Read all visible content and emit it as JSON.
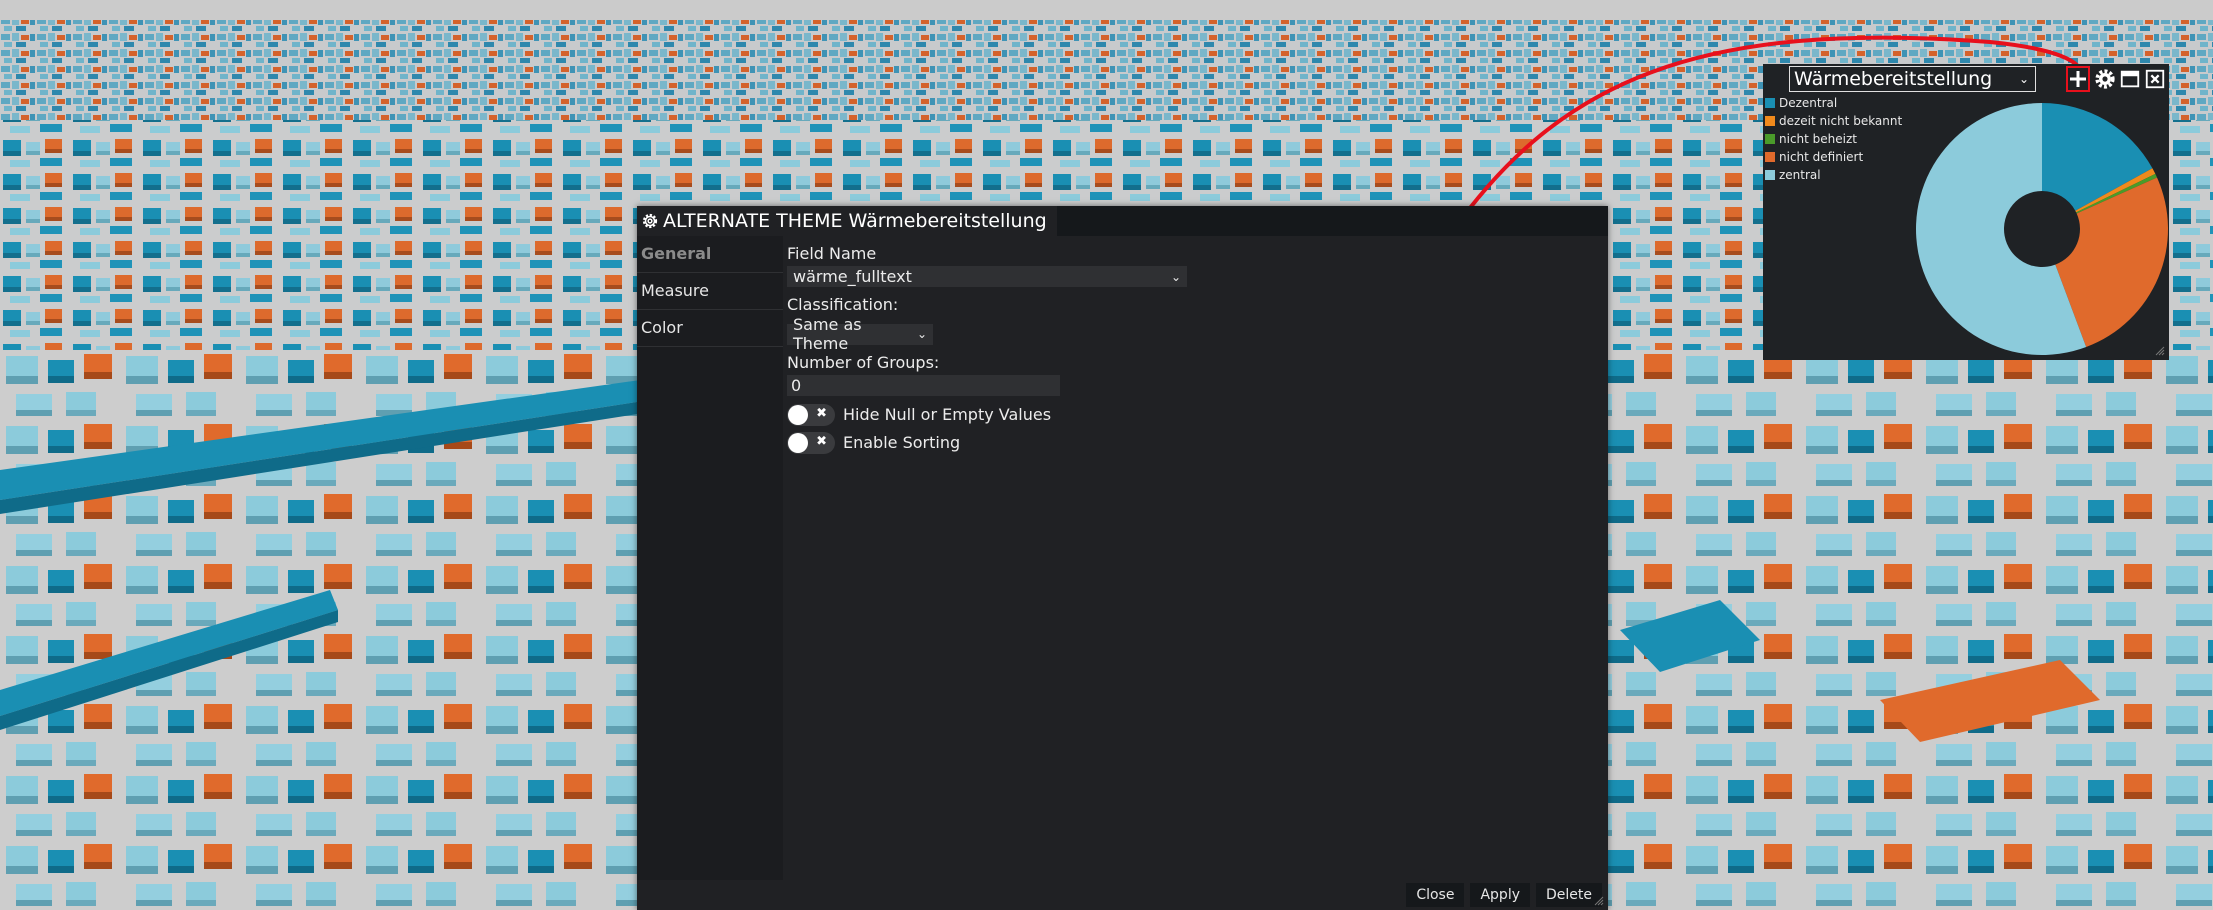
{
  "colors": {
    "dezentral": "#1a8fb3",
    "unknown": "#f08a1c",
    "not_heated": "#4a9b2a",
    "undefined": "#e06a2c",
    "zentral": "#8ccbdb",
    "annotation": "#e8101c"
  },
  "dialog": {
    "icon": "gear-icon",
    "title": "ALTERNATE THEME Wärmebereitstellung",
    "nav": [
      {
        "label": "General"
      },
      {
        "label": "Measure"
      },
      {
        "label": "Color"
      }
    ],
    "field_name": {
      "label": "Field Name",
      "value": "wärme_fulltext"
    },
    "classification": {
      "label": "Classification:",
      "value": "Same as Theme"
    },
    "groups": {
      "label": "Number of Groups:",
      "value": "0"
    },
    "toggles": [
      {
        "label": "Hide Null or Empty Values",
        "on": false
      },
      {
        "label": "Enable Sorting",
        "on": false
      }
    ],
    "buttons": {
      "close": "Close",
      "apply": "Apply",
      "delete": "Delete"
    }
  },
  "chart_panel": {
    "dropdown_value": "Wärmebereitstellung",
    "icons": [
      "plus-icon",
      "gear-icon",
      "window-icon",
      "close-icon"
    ]
  },
  "chart_data": {
    "type": "pie",
    "donut": true,
    "categories": [
      "Dezentral",
      "dezeit nicht bekannt",
      "nicht beheizt",
      "nicht definiert",
      "zentral"
    ],
    "values": [
      17,
      0.8,
      0.5,
      26,
      55.7
    ],
    "colors": [
      "#1a8fb3",
      "#f08a1c",
      "#4a9b2a",
      "#e06a2c",
      "#8ccbdb"
    ],
    "legend_position": "top-left"
  }
}
